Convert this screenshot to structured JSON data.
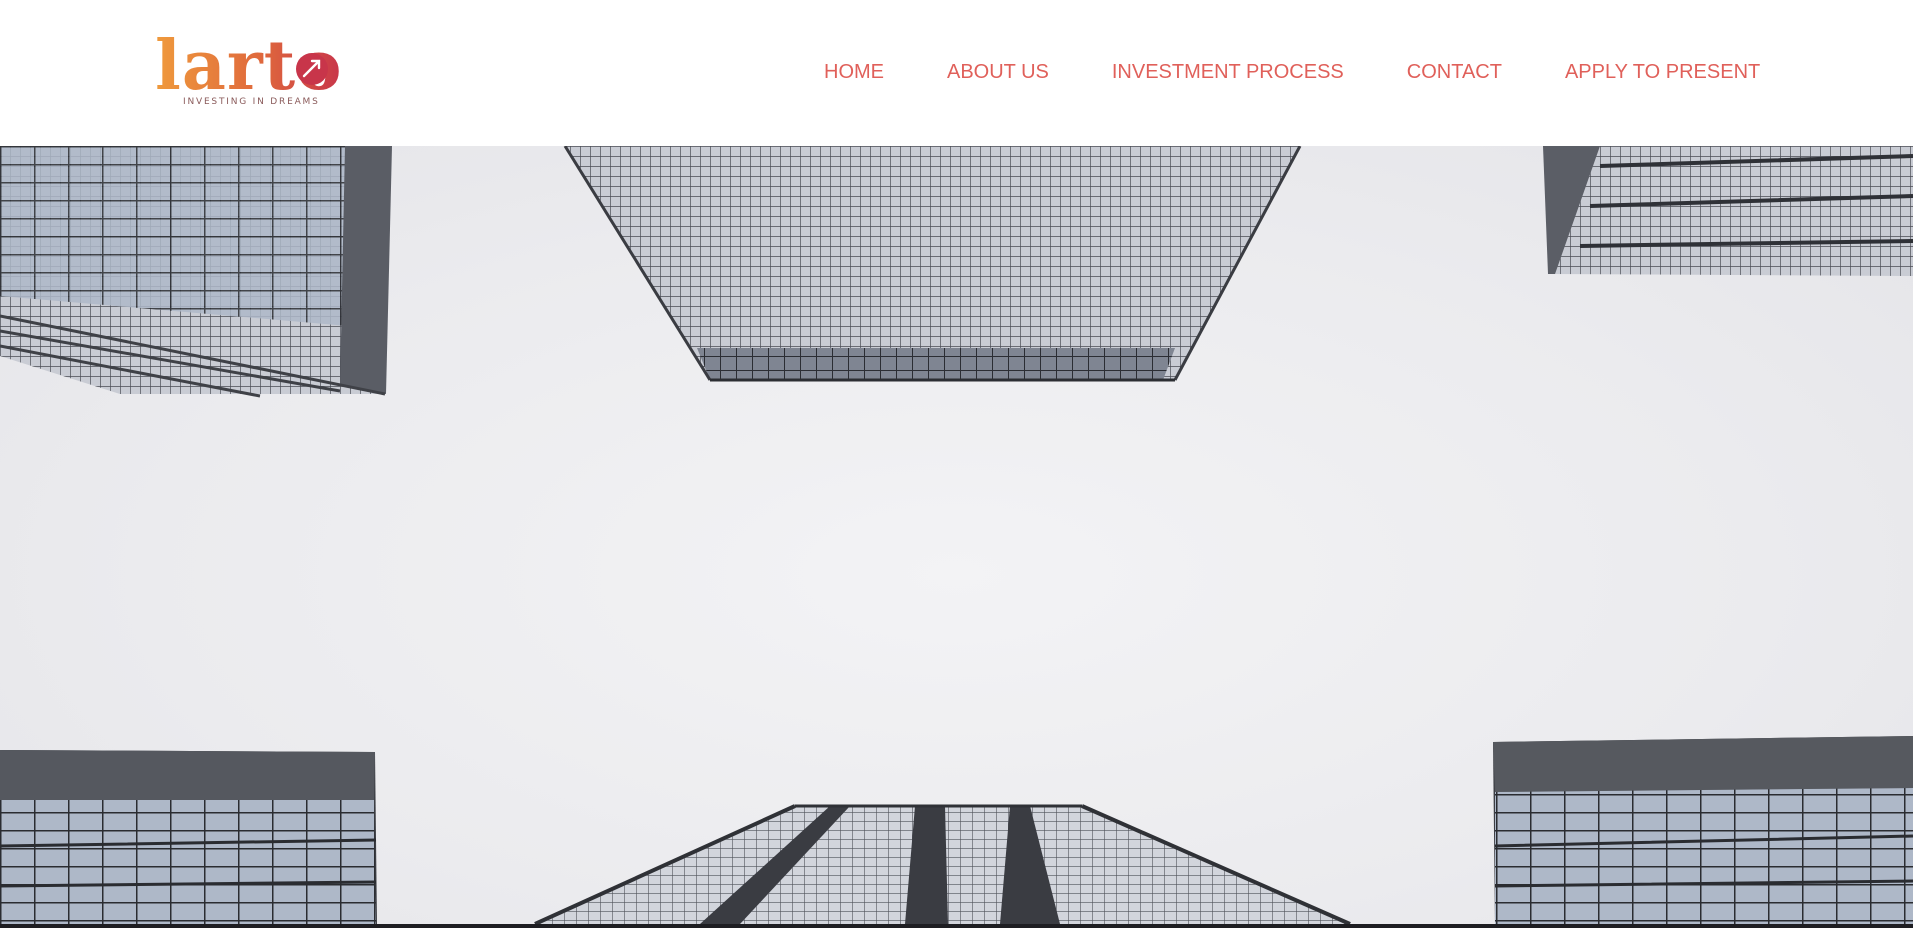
{
  "brand": {
    "name": "larto",
    "tagline": "INVESTING IN DREAMS",
    "colors": {
      "gradient_start": "#ef9a3c",
      "gradient_end": "#c8354a"
    }
  },
  "nav": {
    "items": [
      {
        "label": "HOME"
      },
      {
        "label": "ABOUT US"
      },
      {
        "label": "INVESTMENT PROCESS"
      },
      {
        "label": "CONTACT"
      },
      {
        "label": "APPLY TO PRESENT"
      }
    ],
    "color": "#e0605a"
  },
  "hero": {
    "icon": "skyscrapers-looking-up-image"
  }
}
